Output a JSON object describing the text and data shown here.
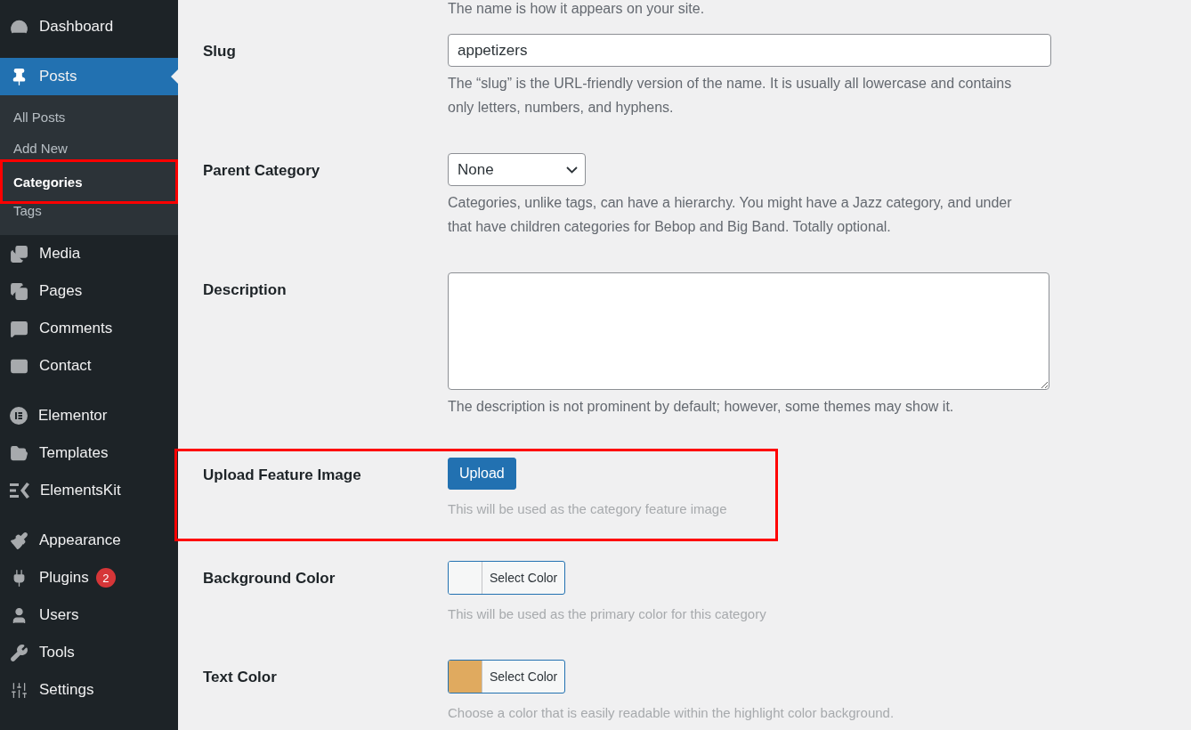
{
  "sidebar": {
    "groups": [
      [
        {
          "label": "Dashboard",
          "selected": false
        }
      ],
      [
        {
          "label": "Posts",
          "selected": true,
          "children": [
            {
              "label": "All Posts",
              "selected": false,
              "highlighted": false
            },
            {
              "label": "Add New",
              "selected": false,
              "highlighted": false
            },
            {
              "label": "Categories",
              "selected": true,
              "highlighted": true
            },
            {
              "label": "Tags",
              "selected": false,
              "highlighted": false
            }
          ]
        },
        {
          "label": "Media",
          "selected": false
        },
        {
          "label": "Pages",
          "selected": false
        },
        {
          "label": "Comments",
          "selected": false
        },
        {
          "label": "Contact",
          "selected": false
        }
      ],
      [
        {
          "label": "Elementor",
          "selected": false
        },
        {
          "label": "Templates",
          "selected": false
        },
        {
          "label": "ElementsKit",
          "selected": false
        }
      ],
      [
        {
          "label": "Appearance",
          "selected": false
        },
        {
          "label": "Plugins",
          "selected": false,
          "badge": "2"
        },
        {
          "label": "Users",
          "selected": false
        },
        {
          "label": "Tools",
          "selected": false
        },
        {
          "label": "Settings",
          "selected": false
        }
      ]
    ]
  },
  "form": {
    "top_hint": "The name is how it appears on your site.",
    "fields": [
      {
        "kind": "text",
        "label": "Slug",
        "value": "appetizers",
        "description": "The “slug” is the URL-friendly version of the name. It is usually all lowercase and contains only letters, numbers, and hyphens.",
        "highlighted": false
      },
      {
        "kind": "select",
        "label": "Parent Category",
        "value": "None",
        "description": "Categories, unlike tags, can have a hierarchy. You might have a Jazz category, and under that have children categories for Bebop and Big Band. Totally optional.",
        "highlighted": false
      },
      {
        "kind": "textarea",
        "label": "Description",
        "description": "The description is not prominent by default; however, some themes may show it.",
        "highlighted": false
      },
      {
        "kind": "upload",
        "label": "Upload Feature Image",
        "button": "Upload",
        "description": "This will be used as the category feature image",
        "highlighted": true
      },
      {
        "kind": "color",
        "label": "Background Color",
        "color": "#f6f7f7",
        "button": "Select Color",
        "description": "This will be used as the primary color for this category",
        "highlighted": false
      },
      {
        "kind": "color",
        "label": "Text Color",
        "color": "#e0aa5f",
        "button": "Select Color",
        "description": "Choose a color that is easily readable within the highlight color background.",
        "highlighted": false
      }
    ]
  }
}
